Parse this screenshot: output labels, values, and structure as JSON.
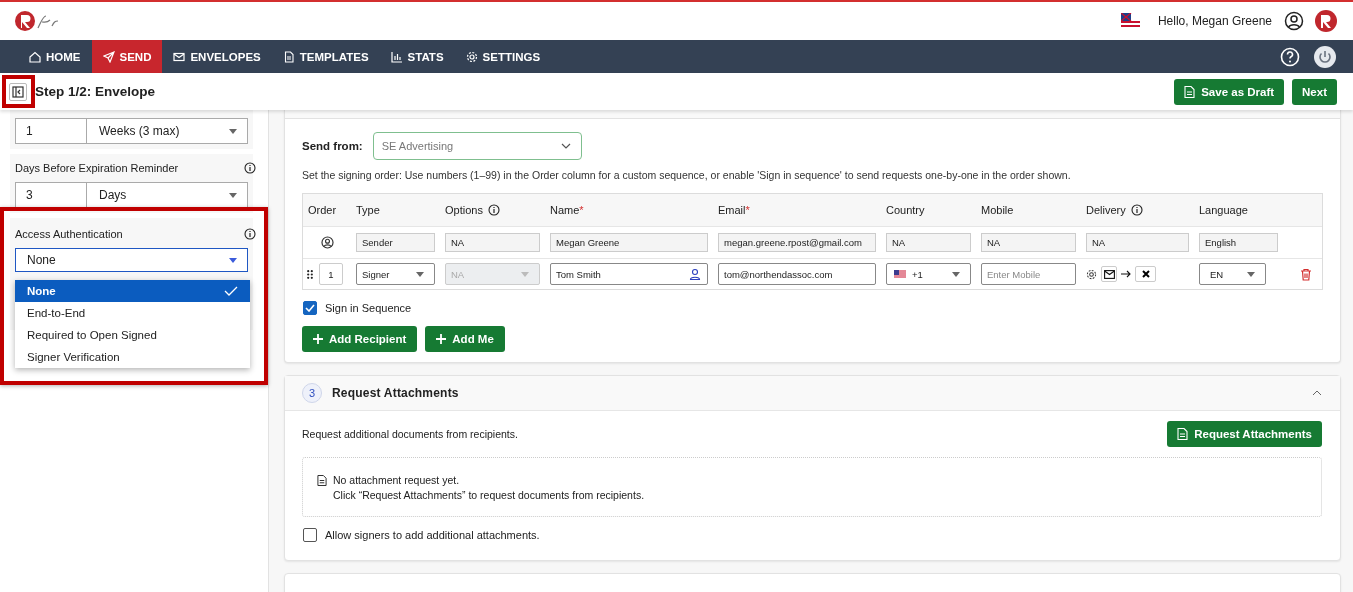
{
  "header": {
    "greeting": "Hello, Megan Greene"
  },
  "nav": [
    {
      "label": "HOME",
      "selected": false
    },
    {
      "label": "SEND",
      "selected": true
    },
    {
      "label": "ENVELOPES",
      "selected": false
    },
    {
      "label": "TEMPLATES",
      "selected": false
    },
    {
      "label": "STATS",
      "selected": false
    },
    {
      "label": "SETTINGS",
      "selected": false
    }
  ],
  "step": {
    "title": "Step 1/2: Envelope",
    "buttons": [
      "Save as Draft",
      "Next"
    ]
  },
  "sidebar": {
    "expiry": {
      "number": "1",
      "unit": "Weeks (3 max)"
    },
    "reminder": {
      "label": "Days Before Expiration Reminder",
      "number": "3",
      "unit": "Days"
    },
    "access": {
      "label": "Access Authentication",
      "value": "None",
      "expanded": true,
      "options": [
        {
          "label": "None",
          "selected": true
        },
        {
          "label": "End-to-End",
          "selected": false
        },
        {
          "label": "Required to Open Signed",
          "selected": false
        },
        {
          "label": "Signer Verification",
          "selected": false
        }
      ]
    }
  },
  "recipients": {
    "send_from_label": "Send from:",
    "send_from": "SE Advertising",
    "hint": "Set the signing order: Use numbers (1–99) in the Order column for a custom sequence, or enable 'Sign in sequence' to send requests one-by-one in the order shown.",
    "columns": [
      {
        "label": "Order"
      },
      {
        "label": "Type"
      },
      {
        "label": "Options",
        "info": true
      },
      {
        "label": "Name",
        "mark": "*"
      },
      {
        "label": "Email",
        "mark": "*"
      },
      {
        "label": "Country"
      },
      {
        "label": "Mobile"
      },
      {
        "label": "Delivery",
        "info": true
      },
      {
        "label": "Language"
      }
    ],
    "sender": {
      "type": "Sender",
      "options": "NA",
      "name": "Megan Greene",
      "email": "megan.greene.rpost@gmail.com",
      "country": "NA",
      "mobile": "NA",
      "delivery": "NA",
      "language": "English"
    },
    "signers": [
      {
        "order": "1",
        "type": "Signer",
        "options": "NA",
        "name": "Tom Smith",
        "email": "tom@northendassoc.com",
        "country_code": "+1",
        "mobile_placeholder": "Enter Mobile",
        "language": "EN"
      }
    ],
    "sign_in_sequence": {
      "label": "Sign in Sequence",
      "checked": true
    },
    "buttons": [
      "Add Recipient",
      "Add Me"
    ]
  },
  "attachments": {
    "number": "3",
    "title": "Request Attachments",
    "expanded": true,
    "intro": "Request additional documents from recipients.",
    "button": "Request Attachments",
    "empty_title": "No attachment request yet.",
    "empty_hint": "Click “Request Attachments” to request documents from recipients.",
    "allow": {
      "label": "Allow signers to add additional attachments.",
      "checked": false
    }
  }
}
